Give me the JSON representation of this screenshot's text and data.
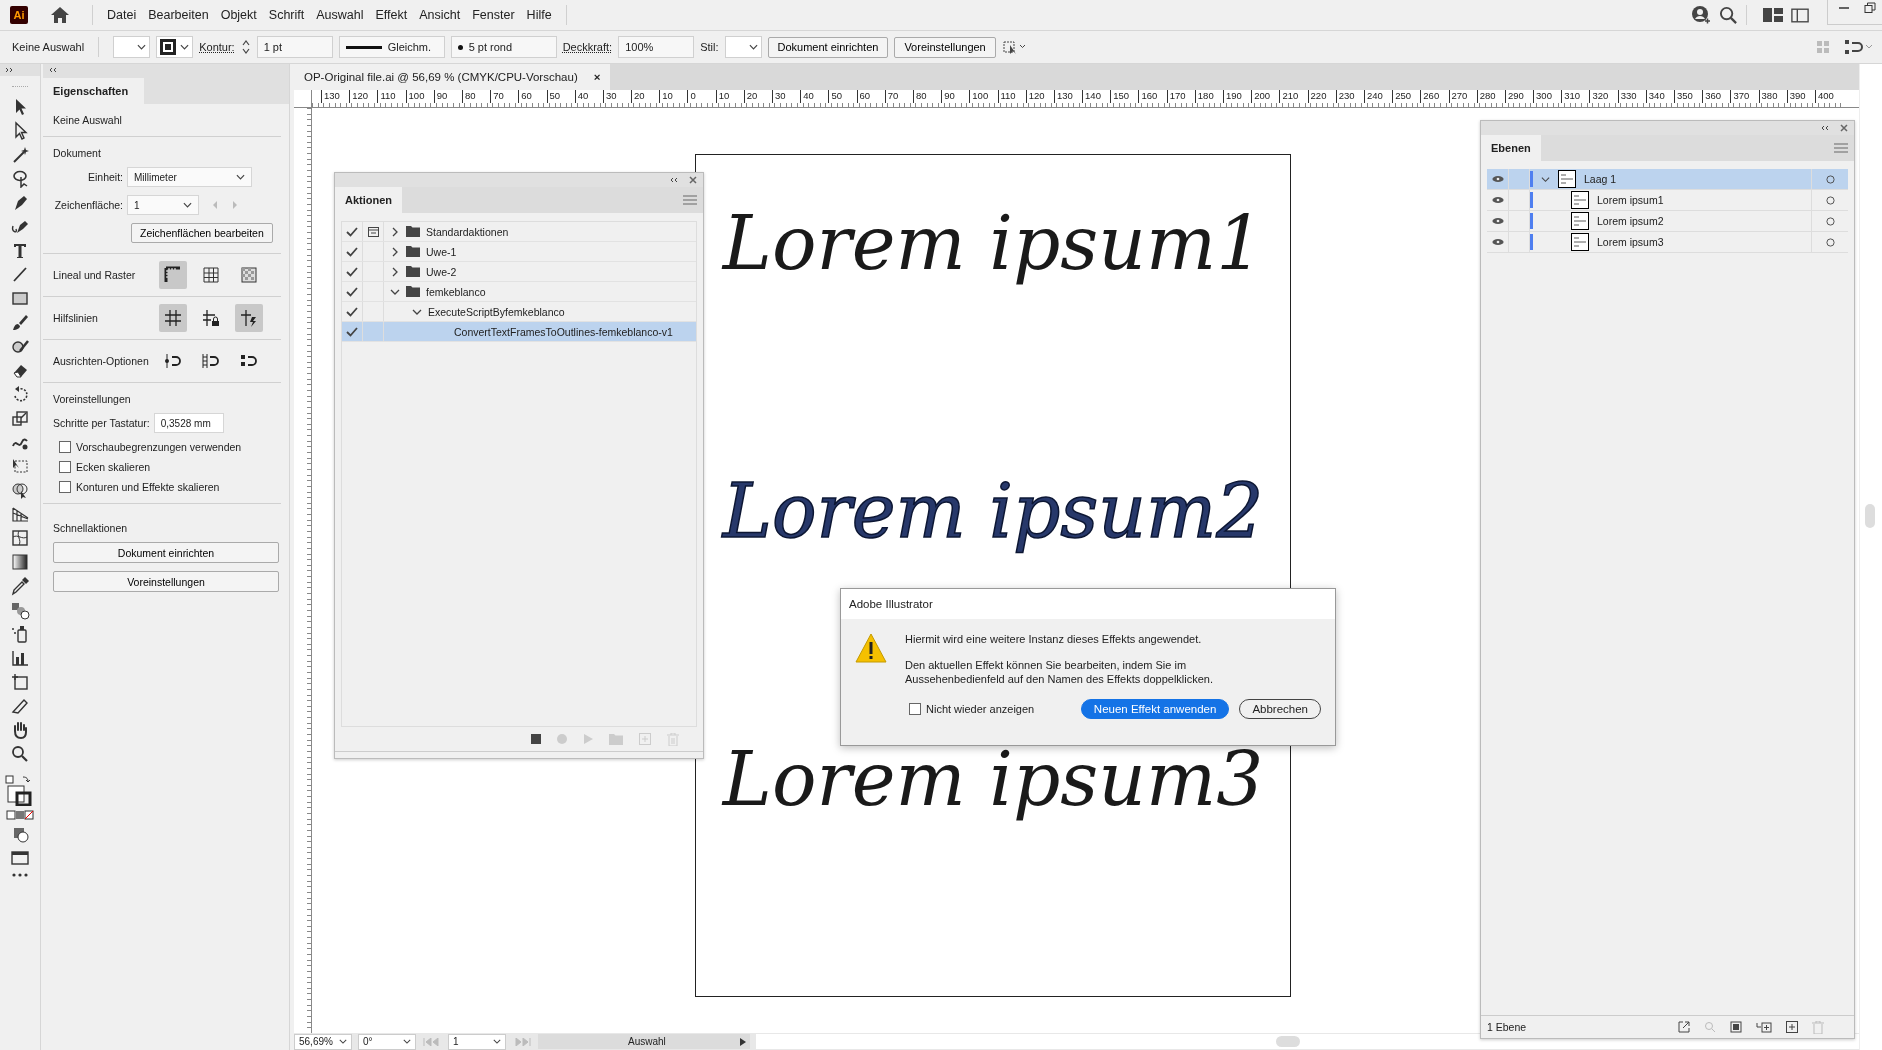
{
  "app_logo": "Ai",
  "menubar": {
    "items": [
      "Datei",
      "Bearbeiten",
      "Objekt",
      "Schrift",
      "Auswahl",
      "Effekt",
      "Ansicht",
      "Fenster",
      "Hilfe"
    ]
  },
  "control_bar": {
    "selection": "Keine Auswahl",
    "stroke_label": "Kontur:",
    "stroke_weight": "1 pt",
    "stroke_profile": "Gleichm.",
    "brush": "5 pt rond",
    "opacity_label": "Deckkraft:",
    "opacity": "100%",
    "style_label": "Stil:",
    "buttons": [
      "Dokument einrichten",
      "Voreinstellungen"
    ]
  },
  "document_tab": {
    "title": "OP-Original file.ai @ 56,69 % (CMYK/CPU-Vorschau)",
    "close": "×"
  },
  "properties": {
    "tab": "Eigenschaften",
    "selection": "Keine Auswahl",
    "document_heading": "Dokument",
    "unit_label": "Einheit:",
    "unit": "Millimeter",
    "artboard_label": "Zeichenfläche:",
    "artboard": "1",
    "edit_artboards": "Zeichenflächen bearbeiten",
    "ruler_grid": "Lineal und Raster",
    "guides": "Hilfslinien",
    "align_options": "Ausrichten-Optionen",
    "preferences_heading": "Voreinstellungen",
    "keyboard_increment_label": "Schritte per Tastatur:",
    "keyboard_increment": "0,3528 mm",
    "checkboxes": [
      {
        "label": "Vorschaubegrenzungen verwenden",
        "checked": false
      },
      {
        "label": "Ecken skalieren",
        "checked": false
      },
      {
        "label": "Konturen und Effekte skalieren",
        "checked": false
      }
    ],
    "quick_actions_heading": "Schnellaktionen",
    "quick_actions": [
      "Dokument einrichten",
      "Voreinstellungen"
    ]
  },
  "ruler": {
    "labels": [
      "130",
      "120",
      "110",
      "100",
      "90",
      "80",
      "70",
      "60",
      "50",
      "40",
      "30",
      "20",
      "10",
      "0",
      "10",
      "20",
      "30",
      "40",
      "50",
      "60",
      "70",
      "80",
      "90",
      "100",
      "110",
      "120",
      "130",
      "140",
      "150",
      "160",
      "170",
      "180",
      "190",
      "200",
      "210",
      "220",
      "230",
      "240",
      "250",
      "260",
      "270",
      "280",
      "290",
      "300",
      "310",
      "320",
      "330",
      "340",
      "350",
      "360",
      "370",
      "380",
      "390",
      "400"
    ]
  },
  "artboard": {
    "texts": [
      {
        "text": "Lorem ipsum1",
        "kind": "filled"
      },
      {
        "text": "Lorem ipsum2",
        "kind": "outlined"
      },
      {
        "text": "Lorem ipsum3",
        "kind": "filled"
      }
    ]
  },
  "actions_panel": {
    "title": "Aktionen",
    "items": [
      {
        "label": "Standardaktionen",
        "kind": "set",
        "checked": true,
        "modal": true,
        "expanded": false,
        "selected": false
      },
      {
        "label": "Uwe-1",
        "kind": "set",
        "checked": true,
        "modal": false,
        "expanded": false,
        "selected": false
      },
      {
        "label": "Uwe-2",
        "kind": "set",
        "checked": true,
        "modal": false,
        "expanded": false,
        "selected": false
      },
      {
        "label": "femkeblanco",
        "kind": "set",
        "checked": true,
        "modal": false,
        "expanded": true,
        "selected": false,
        "children": [
          {
            "label": "ExecuteScriptByfemkeblanco",
            "kind": "action",
            "checked": true,
            "modal": false,
            "expanded": true,
            "selected": false,
            "children": [
              {
                "label": "ConvertTextFramesToOutlines-femkeblanco-v1",
                "kind": "command",
                "checked": true,
                "modal": false,
                "selected": true
              }
            ]
          }
        ]
      }
    ]
  },
  "layers_panel": {
    "title": "Ebenen",
    "layers": [
      {
        "name": "Laag 1",
        "visible": true,
        "selected": true,
        "expanded": true,
        "children": [
          {
            "name": "Lorem ipsum1",
            "visible": true,
            "selected": false
          },
          {
            "name": "Lorem ipsum2",
            "visible": true,
            "selected": false
          },
          {
            "name": "Lorem ipsum3",
            "visible": true,
            "selected": false
          }
        ]
      }
    ],
    "footer": "1 Ebene"
  },
  "dialog": {
    "title": "Adobe Illustrator",
    "message": "Hiermit wird eine weitere Instanz dieses Effekts angewendet.",
    "detail": "Den aktuellen Effekt können Sie bearbeiten, indem Sie im Aussehenbedienfeld auf den Namen des Effekts doppelklicken.",
    "checkbox": {
      "label": "Nicht wieder anzeigen",
      "checked": false
    },
    "buttons": [
      {
        "label": "Neuen Effekt anwenden",
        "kind": "primary"
      },
      {
        "label": "Abbrechen",
        "kind": "secondary"
      }
    ]
  },
  "status_bar": {
    "zoom": "56,69%",
    "rotation": "0°",
    "artboard": "1",
    "tool": "Auswahl"
  }
}
